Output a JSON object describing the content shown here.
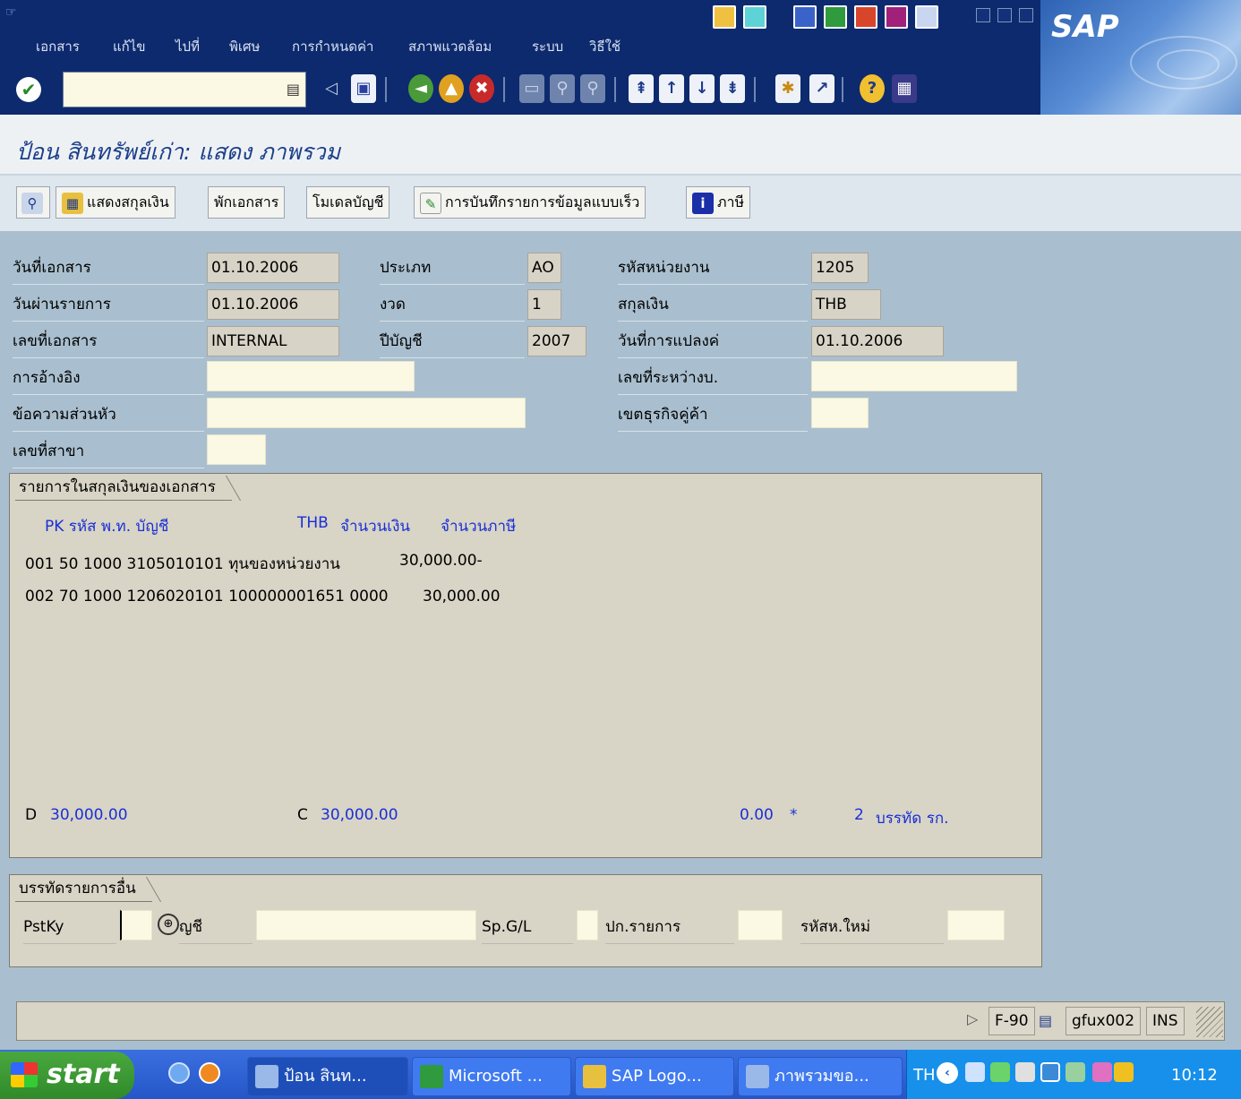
{
  "menu": {
    "items": [
      "เอกสาร",
      "แก้ไข",
      "ไปที่",
      "พิเศษ",
      "การกำหนดค่า",
      "สภาพแวดล้อม",
      "ระบบ",
      "วิธีใช้"
    ]
  },
  "brand": {
    "logo_text": "SAP"
  },
  "toolbar": {
    "command_value": ""
  },
  "page": {
    "title": "ป้อน สินทรัพย์เก่า: แสดง ภาพรวม"
  },
  "app_toolbar": {
    "show_currency": "แสดงสกุลเงิน",
    "park_doc": "พักเอกสาร",
    "acct_model": "โมเดลบัญชี",
    "fast_entry": "การบันทึกรายการข้อมูลแบบเร็ว",
    "tax": "ภาษี"
  },
  "header": {
    "doc_date_label": "วันที่เอกสาร",
    "doc_date": "01.10.2006",
    "post_date_label": "วันผ่านรายการ",
    "post_date": "01.10.2006",
    "doc_no_label": "เลขที่เอกสาร",
    "doc_no": "INTERNAL",
    "reference_label": "การอ้างอิง",
    "reference": "",
    "header_text_label": "ข้อความส่วนหัว",
    "header_text": "",
    "branch_label": "เลขที่สาขา",
    "branch": "",
    "type_label": "ประเภท",
    "type": "AO",
    "period_label": "งวด",
    "period": "1",
    "fiscal_year_label": "ปีบัญชี",
    "fiscal_year": "2007",
    "company_code_label": "รหัสหน่วยงาน",
    "company_code": "1205",
    "currency_label": "สกุลเงิน",
    "currency": "THB",
    "translation_date_label": "วันที่การแปลงค่",
    "translation_date": "01.10.2006",
    "intercompany_label": "เลขที่ระหว่างบ.",
    "intercompany": "",
    "trading_partner_label": "เขตธุรกิจคู่ค้า",
    "trading_partner": ""
  },
  "items_group": {
    "title": "รายการในสกุลเงินของเอกสาร",
    "col_pk": "PK รหัส พ.ท. บัญชี",
    "col_currency": "THB",
    "col_amount": "จำนวนเงิน",
    "col_tax": "จำนวนภาษี",
    "rows": [
      {
        "text": "001 50  1000 3105010101 ทุนของหน่วยงาน",
        "amount": "30,000.00-"
      },
      {
        "text": "002 70  1000 1206020101 100000001651 0000",
        "amount": "30,000.00"
      }
    ],
    "debit_label": "D",
    "debit": "30,000.00",
    "credit_label": "C",
    "credit": "30,000.00",
    "balance": "0.00",
    "balance_flag": "*",
    "line_count": "2",
    "line_count_label": "บรรทัด รก."
  },
  "other_line": {
    "title": "บรรทัดรายการอื่น",
    "pstky_label": "PstKy",
    "pstky": "",
    "account_label": "ญชี",
    "account": "",
    "spgl_label": "Sp.G/L",
    "spgl": "",
    "trans_type_label": "ปก.รายการ",
    "trans_type": "",
    "new_code_label": "รหัสห.ใหม่",
    "new_code": ""
  },
  "status": {
    "tcode": "F-90",
    "server": "gfux002",
    "mode": "INS"
  },
  "taskbar": {
    "start": "start",
    "tasks": [
      "ป้อน สินท...",
      "Microsoft ...",
      "SAP Logo...",
      "ภาพรวมขอ..."
    ],
    "lang": "TH",
    "clock": "10:12"
  }
}
